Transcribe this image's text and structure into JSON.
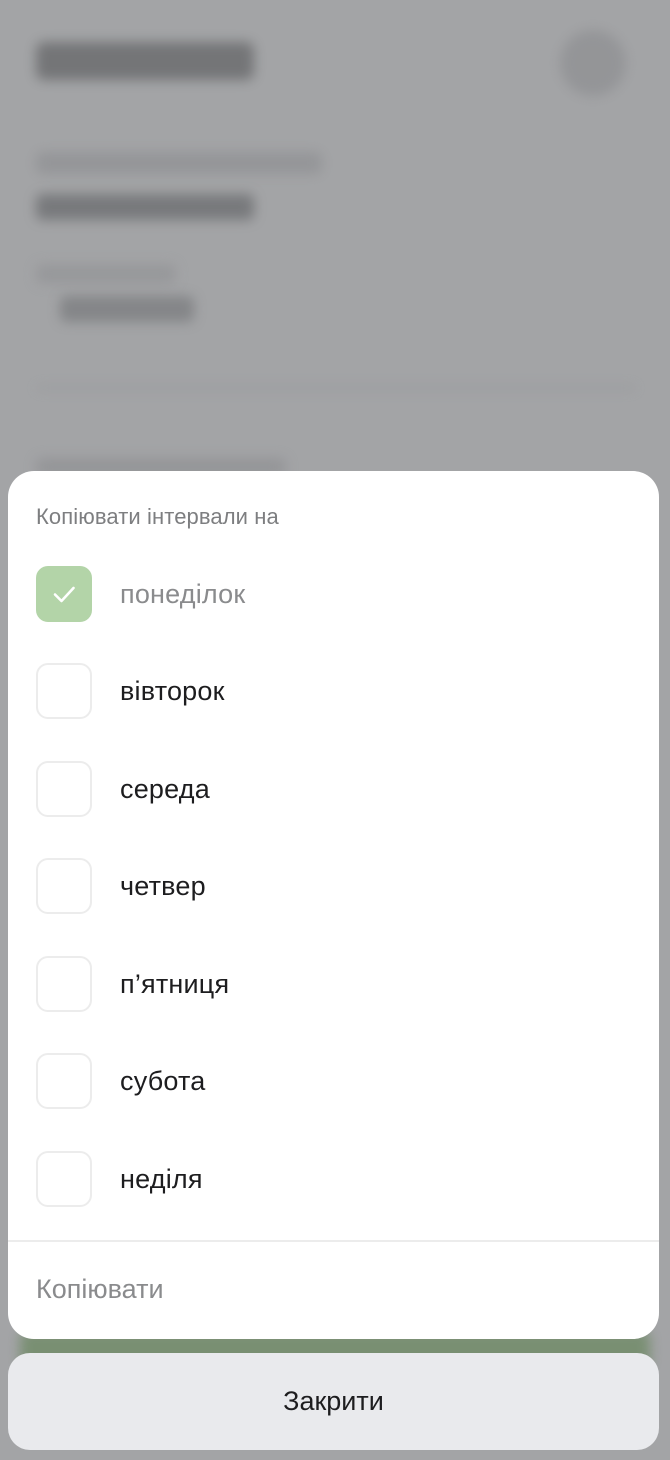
{
  "sheet": {
    "header": "Копіювати інтервали на",
    "days": [
      {
        "label": "понеділок",
        "checked": true
      },
      {
        "label": "вівторок",
        "checked": false
      },
      {
        "label": "середа",
        "checked": false
      },
      {
        "label": "четвер",
        "checked": false
      },
      {
        "label": "п’ятниця",
        "checked": false
      },
      {
        "label": "субота",
        "checked": false
      },
      {
        "label": "неділя",
        "checked": false
      }
    ],
    "copy_label": "Копіювати"
  },
  "close_label": "Закрити",
  "colors": {
    "checked_fill": "#b3d4a8",
    "overlay": "#a3a4a6",
    "sheet_bg": "#ffffff",
    "close_bg": "#e9eaed"
  },
  "icons": {
    "checkmark": "check-icon"
  }
}
